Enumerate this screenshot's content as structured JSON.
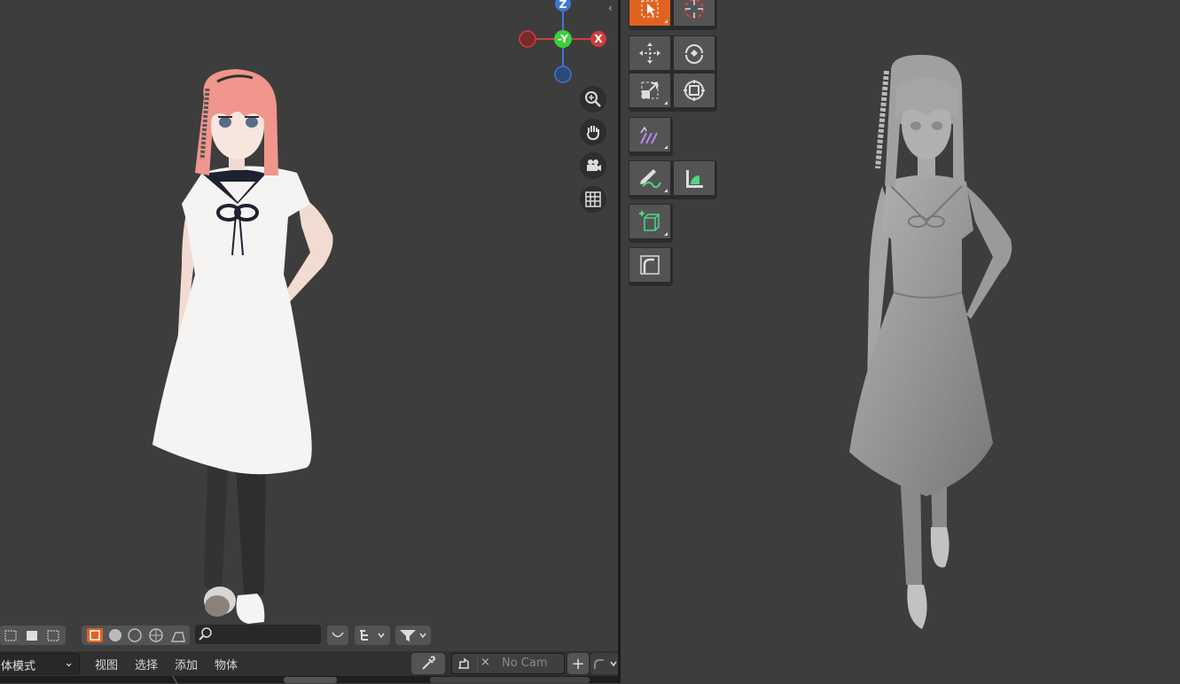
{
  "gizmo": {
    "z_label": "Z",
    "y_label": "-Y",
    "x_label": "X"
  },
  "nav_icons": [
    "zoom-icon",
    "hand-pan-icon",
    "camera-icon",
    "grid-icon"
  ],
  "tool_panel": {
    "tools": [
      "select-box-tool",
      "cursor-tool",
      "move-tool",
      "rotate-tool",
      "scale-tool",
      "transform-tool",
      "annotate-tool",
      "draw-tool",
      "measure-tool",
      "add-cube-tool",
      "extrude-tool"
    ],
    "accent": "#e1621f"
  },
  "header": {
    "search_placeholder": "",
    "filter_icon": "funnel-icon"
  },
  "menu": {
    "mode_label": "体模式",
    "view": "视图",
    "select": "选择",
    "add": "添加",
    "object": "物体",
    "camera_label": "No Cam",
    "camera_close": "×",
    "add_button": "+"
  },
  "colors": {
    "bg": "#3d3d3d",
    "axis_x": "#d13c3c",
    "axis_y": "#3ad13a",
    "axis_z": "#3c78d1",
    "hair": "#f0968c",
    "dress": "#f6f4f2",
    "collar": "#1e2230",
    "clay": "#9a9a9a"
  }
}
